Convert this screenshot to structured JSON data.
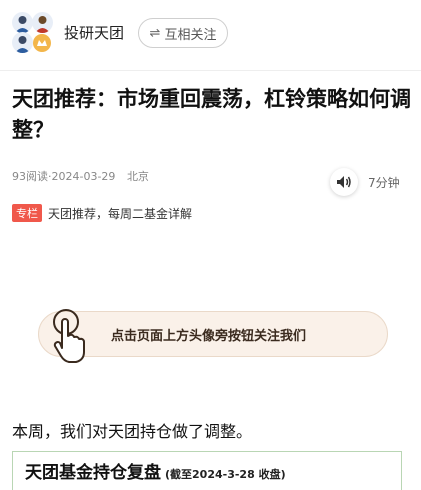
{
  "header": {
    "account_name": "投研天团",
    "follow_label": "互相关注",
    "follow_icon": "swap-arrows-icon"
  },
  "article": {
    "title": "天团推荐：市场重回震荡，杠铃策略如何调整？",
    "read_count": "93阅读",
    "date": "·2024-03-29",
    "location": "北京",
    "audio_duration": "7分钟",
    "column_tag": "专栏",
    "column_text": "天团推荐，每周二基金详解"
  },
  "banner": {
    "text": "点击页面上方头像旁按钮关注我们",
    "icon": "tap-finger-icon"
  },
  "content": {
    "paragraph": "本周，我们对天团持仓做了调整。",
    "card_title": "天团基金持仓复盘",
    "card_date": "(截至2024-3-28 收盘)"
  },
  "colors": {
    "tag": "#f0584b",
    "banner_bg": "#faf1e9",
    "card_border": "#b9d6b4"
  }
}
